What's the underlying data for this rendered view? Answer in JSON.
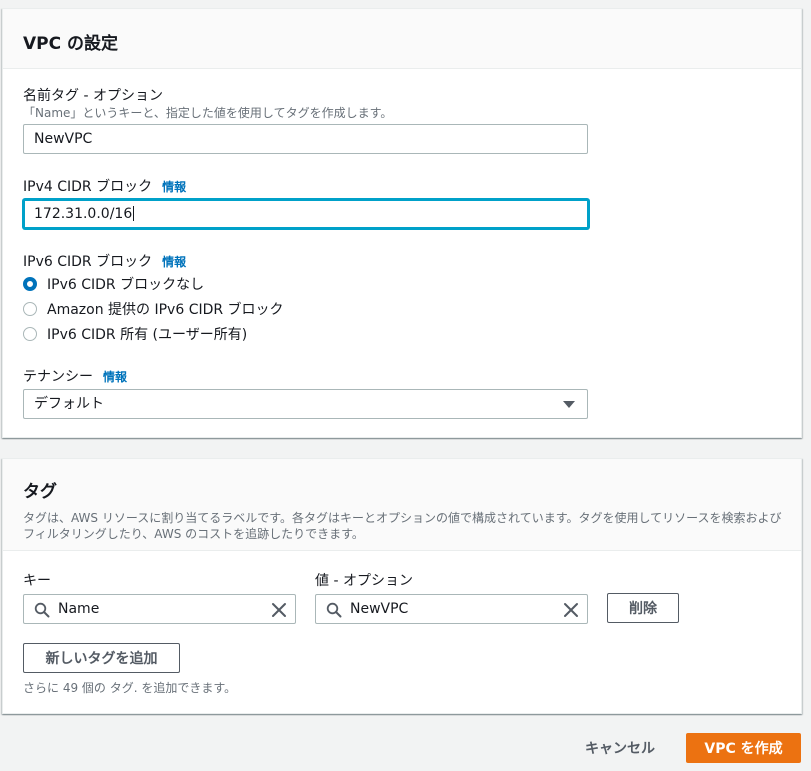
{
  "vpc_settings": {
    "title": "VPC の設定",
    "name_tag": {
      "label": "名前タグ - オプション",
      "description": "「Name」というキーと、指定した値を使用してタグを作成します。",
      "value": "NewVPC"
    },
    "ipv4_cidr": {
      "label": "IPv4 CIDR ブロック",
      "info": "情報",
      "value": "172.31.0.0/16"
    },
    "ipv6_cidr": {
      "label": "IPv6 CIDR ブロック",
      "info": "情報",
      "options": [
        {
          "label": "IPv6 CIDR ブロックなし",
          "checked": true
        },
        {
          "label": "Amazon 提供の IPv6 CIDR ブロック",
          "checked": false
        },
        {
          "label": "IPv6 CIDR 所有 (ユーザー所有)",
          "checked": false
        }
      ]
    },
    "tenancy": {
      "label": "テナンシー",
      "info": "情報",
      "selected": "デフォルト"
    }
  },
  "tags": {
    "title": "タグ",
    "description": "タグは、AWS リソースに割り当てるラベルです。各タグはキーとオプションの値で構成されています。タグを使用してリソースを検索およびフィルタリングしたり、AWS のコストを追跡したりできます。",
    "key_label": "キー",
    "value_label": "値 - オプション",
    "rows": [
      {
        "key": "Name",
        "value": "NewVPC",
        "remove_label": "削除"
      }
    ],
    "add_button": "新しいタグを追加",
    "remaining_hint": "さらに 49 個の タグ. を追加できます。"
  },
  "footer": {
    "cancel": "キャンセル",
    "create": "VPC を作成"
  },
  "colors": {
    "primary": "#ec7211",
    "link": "#0073bb",
    "focus": "#00a1c9"
  }
}
